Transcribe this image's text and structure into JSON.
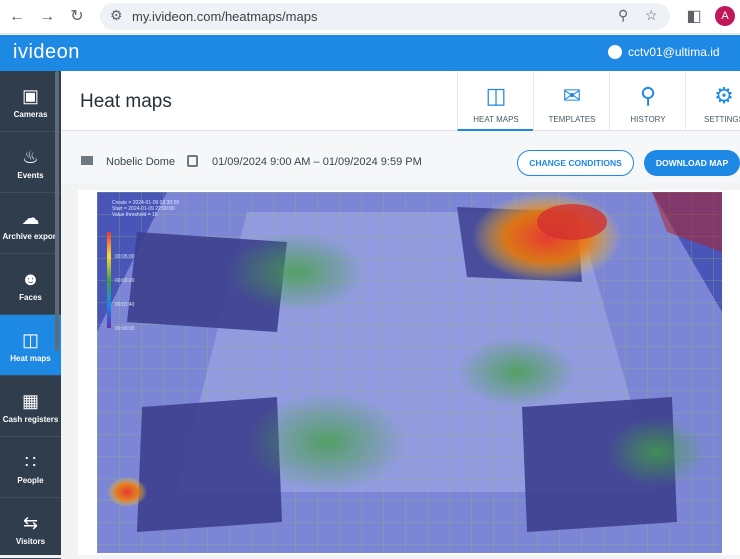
{
  "browser": {
    "url": "my.ivideon.com/heatmaps/maps",
    "profile_initial": "A"
  },
  "app": {
    "logo": "ivideon",
    "user_email": "cctv01@ultima.id"
  },
  "sidebar": {
    "items": [
      {
        "label": "Cameras",
        "icon": "camera-icon"
      },
      {
        "label": "Events",
        "icon": "bell-icon"
      },
      {
        "label": "Archive export",
        "icon": "cloud-download-icon"
      },
      {
        "label": "Faces",
        "icon": "face-scan-icon"
      },
      {
        "label": "Heat maps",
        "icon": "heat-map-icon",
        "active": true
      },
      {
        "label": "Cash registers",
        "icon": "cash-register-icon"
      },
      {
        "label": "People",
        "icon": "people-icon"
      },
      {
        "label": "Visitors",
        "icon": "visitors-arrows-icon"
      }
    ]
  },
  "page": {
    "title": "Heat maps",
    "tabs": [
      {
        "label": "HEAT MAPS",
        "icon": "heat-map-icon",
        "active": true
      },
      {
        "label": "TEMPLATES",
        "icon": "envelope-icon"
      },
      {
        "label": "HISTORY",
        "icon": "search-icon"
      },
      {
        "label": "SETTINGS",
        "icon": "gear-icon"
      }
    ]
  },
  "filters": {
    "camera": "Nobelic Dome",
    "date_range": "01/09/2024 9:00 AM – 01/09/2024 9:59 PM",
    "change_button": "CHANGE CONDITIONS",
    "download_button": "DOWNLOAD MAP"
  },
  "heatmap": {
    "overlay_lines": [
      "Create = 2024-01-09 03:30:00",
      "Start = 2024-01-09 22:00:00",
      "Value threshold = 15"
    ],
    "legend_ticks": [
      "00:05:00",
      "00:03:20",
      "00:01:40",
      "00:00:00"
    ],
    "colors": {
      "hot": "#e53935",
      "warm": "#fdd835",
      "mid": "#43a047",
      "cool": "#1e88e5",
      "cold": "#3949ab"
    }
  }
}
